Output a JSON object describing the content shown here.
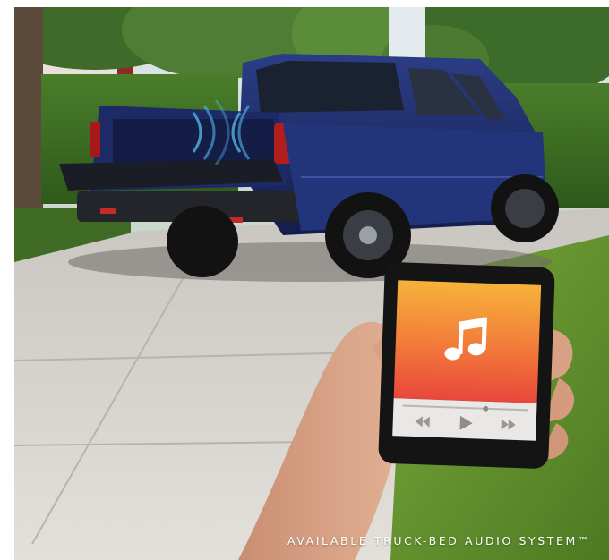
{
  "caption": {
    "text": "AVAILABLE TRUCK-BED AUDIO SYSTEM™"
  },
  "scene": {
    "vehicle": "blue pickup truck with open tailgate",
    "phone_app": "music player",
    "icons": [
      "music-note-icon",
      "rewind-icon",
      "play-icon",
      "fast-forward-icon"
    ],
    "colors": {
      "truck": "#1f2e6b",
      "phone_screen_top": "#f7b23b",
      "phone_screen_bottom": "#e8473b",
      "lawn": "#5e8f2c",
      "driveway": "#d9d6d0"
    }
  }
}
